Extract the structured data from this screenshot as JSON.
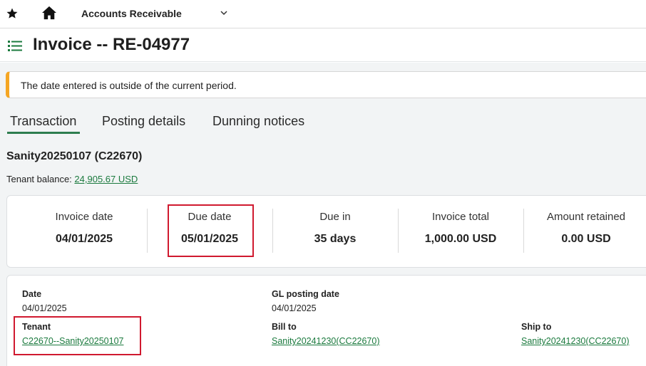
{
  "topbar": {
    "app_title": "Accounts Receivable",
    "icons": [
      "star-icon",
      "home-icon",
      "chevron-down-icon"
    ]
  },
  "header": {
    "title": "Invoice -- RE-04977",
    "icon": "list-icon"
  },
  "alert": {
    "message": "The date entered is outside of the current period.",
    "accent": "#f5a623"
  },
  "tabs": [
    {
      "label": "Transaction",
      "active": true
    },
    {
      "label": "Posting details",
      "active": false
    },
    {
      "label": "Dunning notices",
      "active": false
    }
  ],
  "customer": {
    "name": "Sanity20250107 (C22670)",
    "balance_label": "Tenant balance:",
    "balance_value": "24,905.67 USD"
  },
  "summary": {
    "invoice_date": {
      "label": "Invoice date",
      "value": "04/01/2025"
    },
    "due_date": {
      "label": "Due date",
      "value": "05/01/2025"
    },
    "due_in": {
      "label": "Due in",
      "value": "35 days"
    },
    "invoice_total": {
      "label": "Invoice total",
      "value": "1,000.00 USD"
    },
    "amount_retained": {
      "label": "Amount retained",
      "value": "0.00 USD"
    }
  },
  "details": {
    "date": {
      "label": "Date",
      "value": "04/01/2025"
    },
    "gl_posting_date": {
      "label": "GL posting date",
      "value": "04/01/2025"
    },
    "tenant": {
      "label": "Tenant",
      "value": "C22670--Sanity20250107"
    },
    "bill_to": {
      "label": "Bill to",
      "value": "Sanity20241230(CC22670)"
    },
    "ship_to": {
      "label": "Ship to",
      "value": "Sanity20241230(CC22670)"
    }
  },
  "colors": {
    "accent_green": "#1b7a3e",
    "highlight_red": "#d0192f",
    "warning_orange": "#f5a623"
  }
}
